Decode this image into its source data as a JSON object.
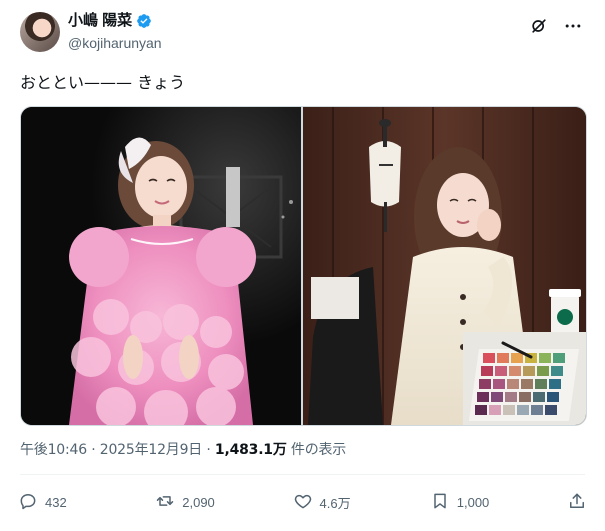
{
  "author": {
    "display_name": "小嶋 陽菜",
    "handle": "@kojiharunyan",
    "verified": true
  },
  "header": {
    "grok_icon": "grok-icon",
    "more_icon": "more-icon"
  },
  "tweet": {
    "text": "おととい——— きょう",
    "media_count": 2
  },
  "meta": {
    "time": "午後10:46",
    "separator1": "·",
    "date": "2025年12月9日",
    "separator2": "·",
    "views": "1,483.1万",
    "views_label": " 件の表示"
  },
  "actions": {
    "replies": "432",
    "reposts": "2,090",
    "likes": "4.6万",
    "bookmarks": "1,000"
  },
  "colors": {
    "verified": "#1d9bf0",
    "secondary_text": "#536471",
    "border": "#cfd9de"
  }
}
